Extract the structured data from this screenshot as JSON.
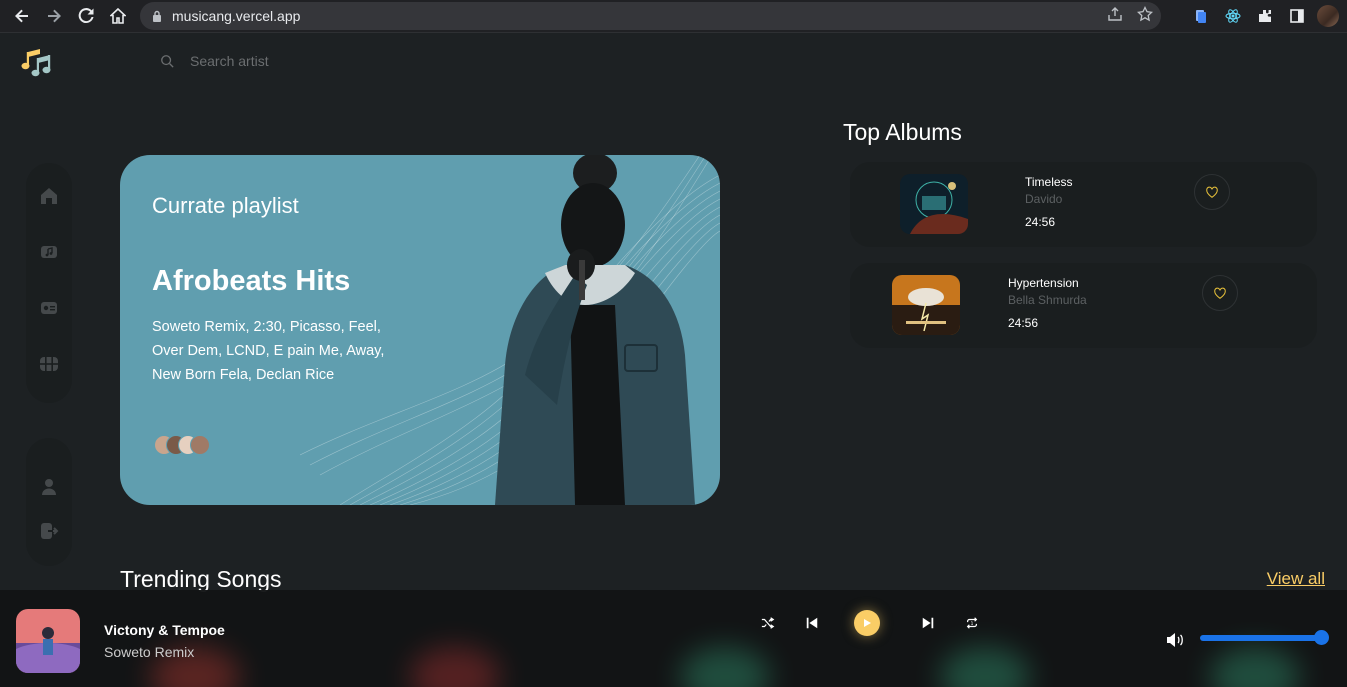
{
  "browser": {
    "url": "musicang.vercel.app"
  },
  "search": {
    "placeholder": "Search artist"
  },
  "sidebar": {
    "items": [
      {
        "icon": "home-icon"
      },
      {
        "icon": "music-library-icon"
      },
      {
        "icon": "radio-icon"
      },
      {
        "icon": "videos-icon"
      }
    ],
    "bottom_items": [
      {
        "icon": "profile-icon"
      },
      {
        "icon": "logout-icon"
      }
    ]
  },
  "hero": {
    "subtitle": "Currate playlist",
    "title": "Afrobeats Hits",
    "description": "Soweto Remix, 2:30, Picasso, Feel, Over Dem, LCND, E pain Me, Away, New Born Fela, Declan Rice",
    "background_color": "#609eaf"
  },
  "top_albums": {
    "title": "Top Albums",
    "items": [
      {
        "name": "Timeless",
        "artist": "Davido",
        "duration": "24:56"
      },
      {
        "name": "Hypertension",
        "artist": "Bella Shmurda",
        "duration": "24:56"
      }
    ]
  },
  "trending": {
    "title": "Trending Songs",
    "view_all": "View all"
  },
  "player": {
    "artist": "Victony & Tempoe",
    "song": "Soweto Remix",
    "volume": 1.0,
    "accent_color": "#facd66",
    "volume_color": "#1a73e8"
  }
}
